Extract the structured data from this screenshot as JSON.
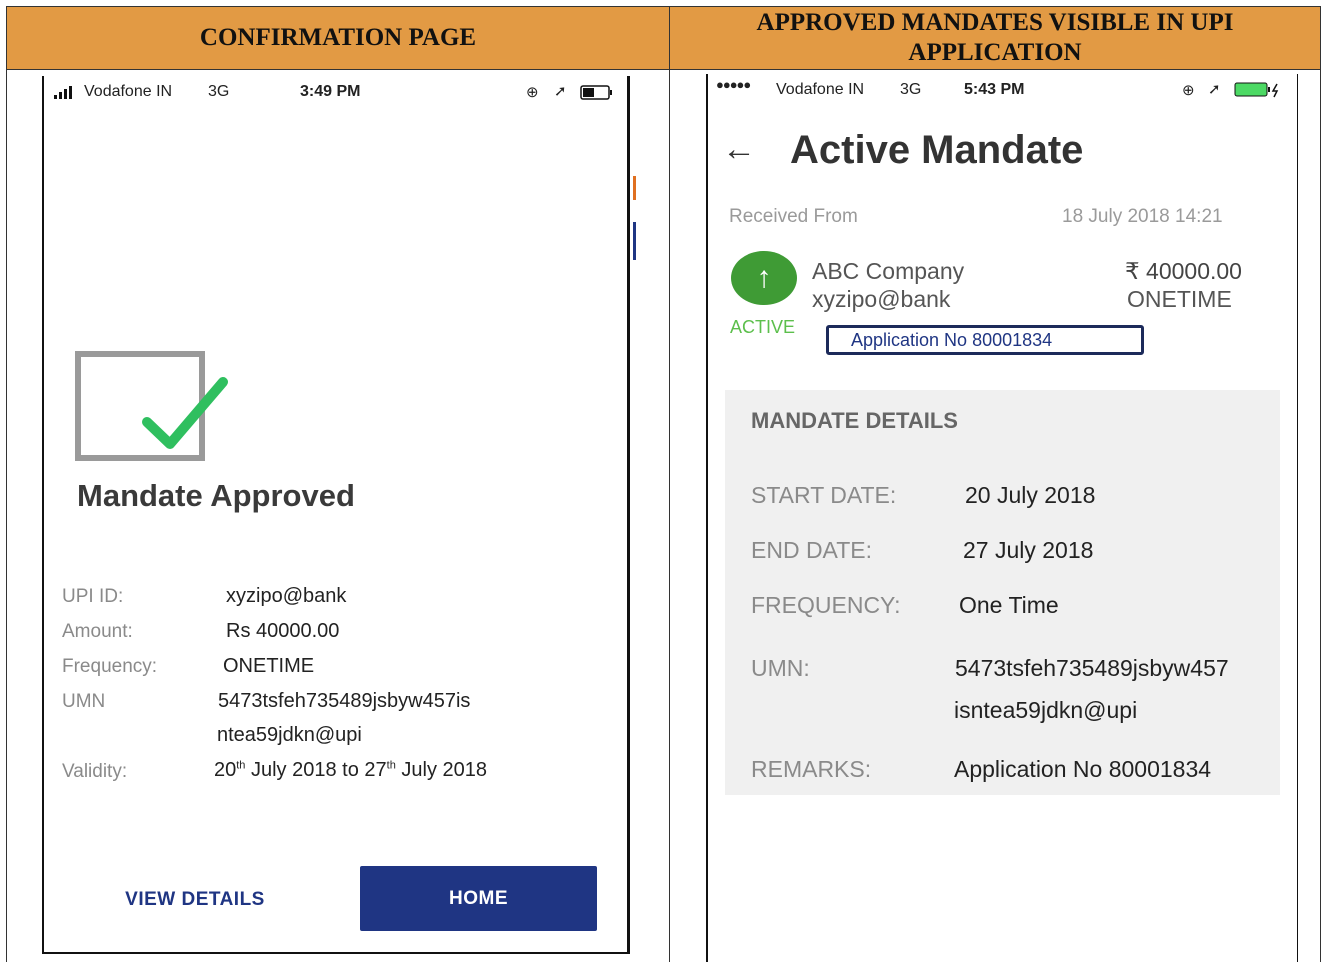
{
  "headers": {
    "left": "CONFIRMATION PAGE",
    "right": "APPROVED MANDATES VISIBLE IN UPI APPLICATION"
  },
  "left_phone": {
    "status": {
      "carrier": "Vodafone IN",
      "network": "3G",
      "time": "3:49 PM"
    },
    "title": "Mandate Approved",
    "details": {
      "upi_label": "UPI ID:",
      "upi_value": "xyzipo@bank",
      "amount_label": "Amount:",
      "amount_value": "Rs 40000.00",
      "frequency_label": "Frequency:",
      "frequency_value": "ONETIME",
      "umn_label": "UMN",
      "umn_line1": "5473tsfeh735489jsbyw457is",
      "umn_line2": "ntea59jdkn@upi",
      "validity_label": "Validity:",
      "validity_start_day": "20",
      "validity_start_sup": "th",
      "validity_start_rest": " July 2018 to ",
      "validity_end_day": "27",
      "validity_end_sup": "th",
      "validity_end_rest": " July 2018"
    },
    "buttons": {
      "view_details": "VIEW DETAILS",
      "home": "HOME"
    }
  },
  "right_phone": {
    "status": {
      "carrier": "Vodafone IN",
      "network": "3G",
      "time": "5:43 PM"
    },
    "title": "Active Mandate",
    "received_label": "Received From",
    "received_datetime": "18 July 2018 14:21",
    "payee_name": "ABC Company",
    "payee_vpa": "xyzipo@bank",
    "amount": "₹ 40000.00",
    "frequency": "ONETIME",
    "status_badge": "ACTIVE",
    "application_no": "Application No 80001834",
    "details_card": {
      "heading": "MANDATE DETAILS",
      "start_label": "START DATE:",
      "start_value": "20 July 2018",
      "end_label": "END DATE:",
      "end_value": "27 July 2018",
      "freq_label": "FREQUENCY:",
      "freq_value": "One Time",
      "umn_label": "UMN:",
      "umn_line1": "5473tsfeh735489jsbyw457",
      "umn_line2": "isntea59jdkn@upi",
      "remarks_label": "REMARKS:",
      "remarks_value": "Application No 80001834"
    }
  },
  "colors": {
    "header_bg": "#e29a44",
    "green": "#3f9b35",
    "navy": "#1f3583",
    "card_bg": "#f0f0f0"
  }
}
